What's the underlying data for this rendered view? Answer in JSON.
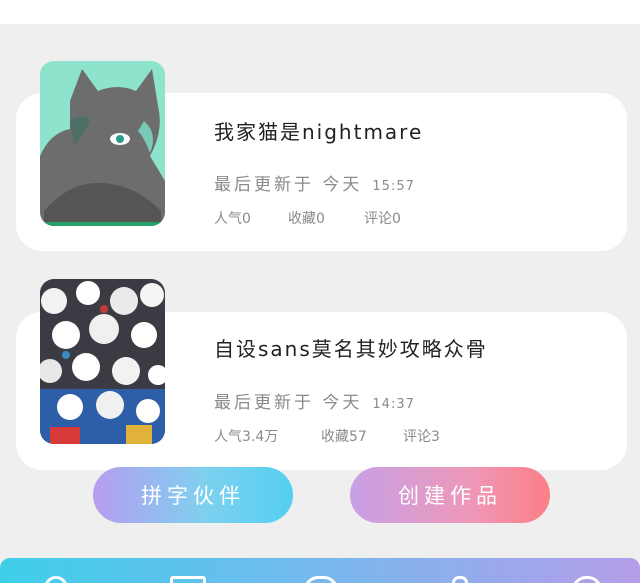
{
  "works": [
    {
      "title": "我家猫是nightmare",
      "updated_label": "最后更新于 今天",
      "updated_time": "15:57",
      "popularity": "人气0",
      "favorites": "收藏0",
      "comments": "评论0"
    },
    {
      "title": "自设sans莫名其妙攻略众骨",
      "updated_label": "最后更新于 今天",
      "updated_time": "14:37",
      "popularity": "人气3.4万",
      "favorites": "收藏57",
      "comments": "评论3"
    }
  ],
  "actions": {
    "partner_label": "拼字伙伴",
    "create_label": "创建作品"
  },
  "colors": {
    "page_background": "#efefef",
    "card_background": "#ffffff",
    "partner_gradient": [
      "#b79cef",
      "#54cff0"
    ],
    "create_gradient": [
      "#c7a0e6",
      "#fb7f86"
    ],
    "bottom_bar_gradient": [
      "#3ecfe9",
      "#b59ce8"
    ]
  },
  "icons": {
    "bottom_nav": [
      "home-icon",
      "book-icon",
      "message-icon",
      "profile-icon",
      "more-icon"
    ]
  }
}
